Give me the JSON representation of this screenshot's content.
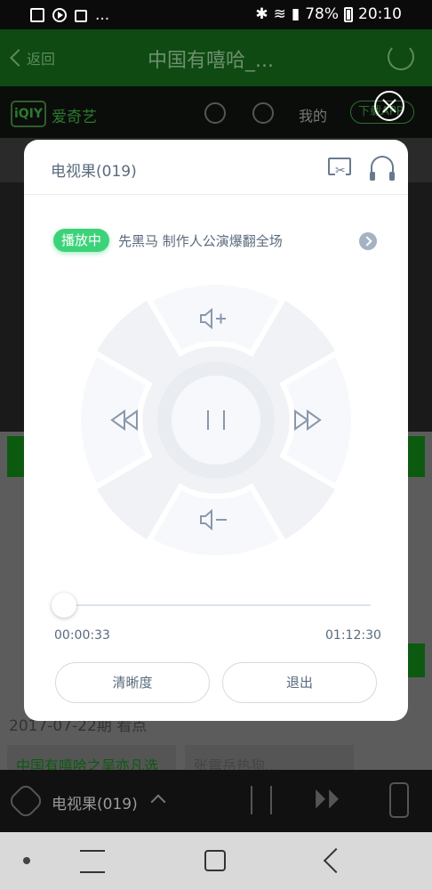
{
  "status_bar": {
    "left_icons": [
      "gallery-icon",
      "play-icon",
      "bag-icon"
    ],
    "overflow": "...",
    "battery": "78%",
    "time": "20:10"
  },
  "background_app": {
    "back_label": "返回",
    "title": "中国有嘻哈_...",
    "brand": "爱奇艺",
    "mine": "我的",
    "download": "下载APP",
    "date_text": "2017-07-22期 看点",
    "chips": [
      "中国有嘻哈之吴亦凡选",
      "张震岳热狗..."
    ]
  },
  "dialog": {
    "title": "电视果(019)",
    "now_playing_badge": "播放中",
    "now_playing_title": "先黑马 制作人公演爆翻全场",
    "progress": 0.0,
    "time_current": "00:00:33",
    "time_total": "01:12:30",
    "btn_quality": "清晰度",
    "btn_exit": "退出"
  },
  "player_bar": {
    "device": "电视果(019)"
  },
  "colors": {
    "accent_green": "#3cd27a",
    "text_slate": "#5a6a7e",
    "pad_bg": "#f0f2f6"
  }
}
